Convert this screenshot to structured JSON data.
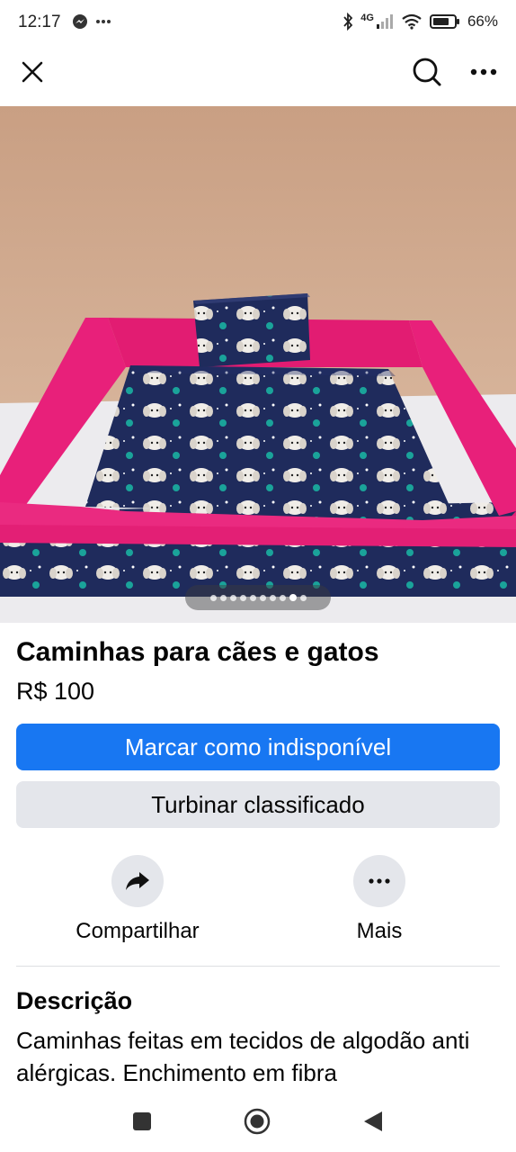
{
  "status_bar": {
    "time": "12:17",
    "notification_icons": [
      "messenger-icon",
      "more-notifications-icon"
    ],
    "network": "4G",
    "battery": "66%"
  },
  "top_bar": {
    "close_icon": "close-icon",
    "search_icon": "search-icon",
    "more_icon": "more-icon"
  },
  "gallery": {
    "photo_count": 10,
    "active_index": 8
  },
  "listing": {
    "title": "Caminhas para cães e gatos",
    "price": "R$ 100"
  },
  "buttons": {
    "mark_unavailable": "Marcar como indisponível",
    "boost": "Turbinar classificado"
  },
  "actions": {
    "share_label": "Compartilhar",
    "more_label": "Mais"
  },
  "description": {
    "heading": "Descrição",
    "text": "Caminhas feitas em tecidos de algodão anti alérgicas. Enchimento em fibra"
  },
  "colors": {
    "primary": "#1877f2",
    "secondary_button": "#e4e6eb",
    "bed_pink": "#e61e6e",
    "bed_navy": "#1e2a5a"
  }
}
